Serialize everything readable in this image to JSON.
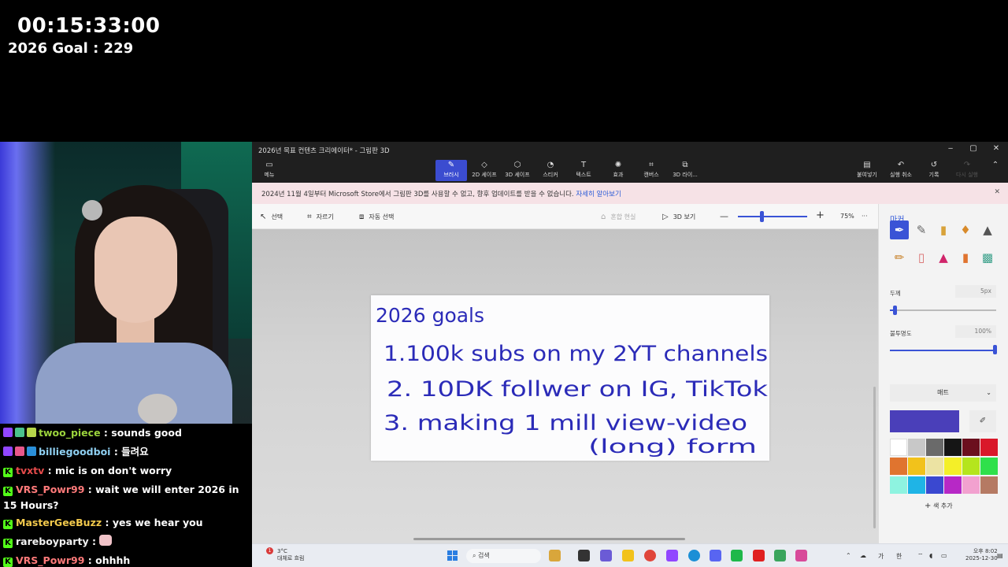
{
  "overlay": {
    "timer": "00:15:33:00",
    "goal": "2026 Goal : 229"
  },
  "chat": {
    "messages": [
      {
        "user": "twoo_piece",
        "user_color": "#9bd43c",
        "text": " : sounds good"
      },
      {
        "user": "billiegoodboi",
        "user_color": "#8fd0f2",
        "text": " : 들려요"
      },
      {
        "user": "tvxtv",
        "user_color": "#e64b4b",
        "text": " : mic is on don't worry"
      },
      {
        "user": "VRS_Powr99",
        "user_color": "#ff7a7a",
        "text": " : wait we will enter 2026 in 15 Hours?"
      },
      {
        "user": "MasterGeeBuzz",
        "user_color": "#f2c94c",
        "text": " : yes we hear you"
      },
      {
        "user": "rareboyparty",
        "user_color": "#f2f2f2",
        "text": " : "
      },
      {
        "user": "VRS_Powr99",
        "user_color": "#ff7a7a",
        "text": " : ohhhh"
      }
    ]
  },
  "window": {
    "title": "2026년 목표 컨텐츠 크리에이터* - 그림판 3D",
    "controls": {
      "minimize": "‒",
      "maximize": "▢",
      "close": "✕"
    }
  },
  "ribbon": {
    "menu": "메뉴",
    "tools": [
      "브러시",
      "2D 셰이프",
      "3D 셰이프",
      "스티커",
      "텍스트",
      "효과",
      "캔버스",
      "3D 라이..."
    ],
    "right": [
      "붙여넣기",
      "실행 취소",
      "기록",
      "다시 실행"
    ]
  },
  "notice": {
    "text": "2024년 11월 4일부터 Microsoft Store에서 그림판 3D를 사용할 수 없고, 향후 업데이트를 받을 수 없습니다.",
    "link": "자세히 알아보기"
  },
  "toolbar": {
    "select": "선택",
    "crop": "자르기",
    "magic_select": "자동 선택",
    "mixed_reality": "혼합 현실",
    "view_3d": "3D 보기",
    "zoom_minus": "—",
    "zoom_plus": "+",
    "zoom_value": "75%",
    "more": "···"
  },
  "canvas": {
    "lines": [
      "2026 goals",
      "1.100k subs on my 2YT channels",
      "2. 10DK follwer on IG, TikTok",
      "3. making 1 mill view-video",
      "(long) form"
    ]
  },
  "side_panel": {
    "title": "마커",
    "thickness_label": "두께",
    "thickness_value": "5px",
    "opacity_label": "불투명도",
    "opacity_value": "100%",
    "finish": "매트",
    "add_color": "색 추가",
    "current_color": "#4a3fb9",
    "palette": [
      "#ffffff",
      "#c8c8c8",
      "#6a6a6a",
      "#151515",
      "#6b0f1e",
      "#d9182a",
      "#e0742f",
      "#f2c21b",
      "#ece3a3",
      "#f4ef28",
      "#b5e51d",
      "#2fe04b",
      "#8ef3e0",
      "#1fb4e6",
      "#3a48d0",
      "#b728c6",
      "#f2a1cf",
      "#b57a63"
    ]
  },
  "taskbar": {
    "weather_temp": "3°C",
    "weather_text": "대체로 흐림",
    "badge": "1",
    "search_placeholder": "검색",
    "tray_lang": "가",
    "tray_ime": "한",
    "time": "오후 8:02",
    "date": "2025-12-30"
  }
}
